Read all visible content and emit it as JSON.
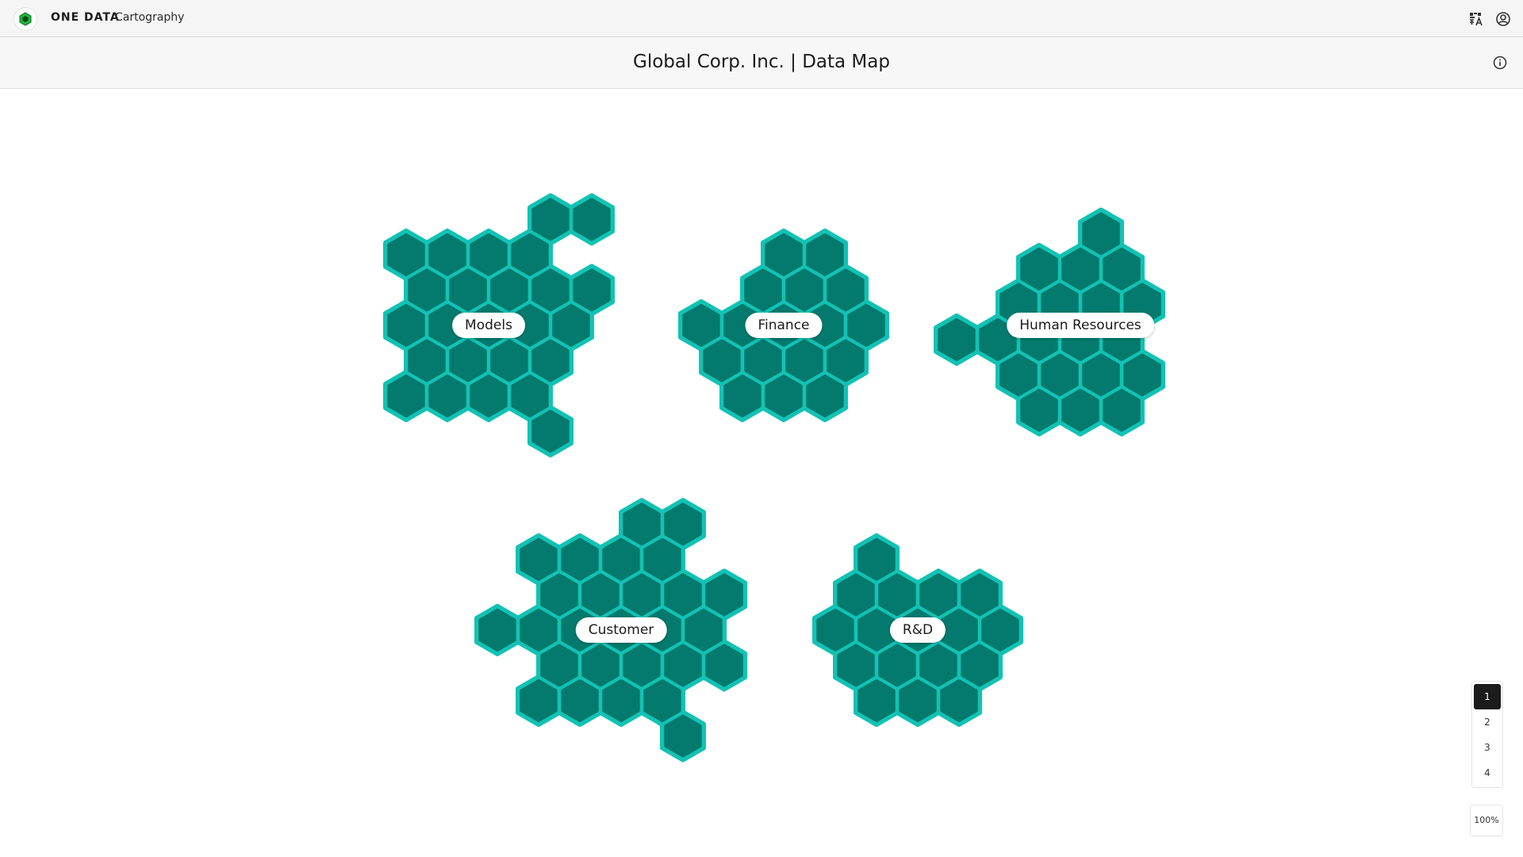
{
  "header": {
    "brand": "ONE DATA",
    "app_name": "Cartography",
    "icons": [
      "translate-icon",
      "user-profile-icon"
    ]
  },
  "subheader": {
    "title": "Global Corp. Inc. | Data Map",
    "icons": [
      "info-icon"
    ]
  },
  "colors": {
    "hex_fill": "#037a6d",
    "hex_gap": "#13c2b4",
    "brand_green": "#1fb53c",
    "active_page": "#1b1b1b"
  },
  "map": {
    "clusters": [
      {
        "name": "Models"
      },
      {
        "name": "Finance"
      },
      {
        "name": "Human Resources"
      },
      {
        "name": "Customer"
      },
      {
        "name": "R&D"
      }
    ]
  },
  "pagination": {
    "pages": [
      "1",
      "2",
      "3",
      "4"
    ],
    "active": "1"
  },
  "zoom": {
    "level": "100%"
  }
}
